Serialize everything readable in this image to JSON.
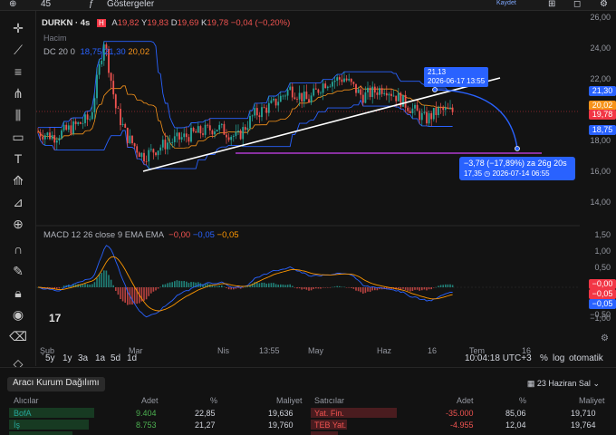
{
  "topbar": {
    "count": "45",
    "indicators_label": "Göstergeler",
    "save_label": "Kaydet"
  },
  "legend": {
    "symbol": "DURKN · 4s",
    "ohlc": {
      "a_label": "A",
      "a": "19,82",
      "y_label": "Y",
      "y": "19,83",
      "d_label": "D",
      "d": "19,69",
      "k_label": "K",
      "k": "19,78",
      "change": "−0,04 (−0,20%)"
    },
    "volume_label": "Hacim",
    "dc_label": "DC 20 0",
    "dc_values": [
      "18,75",
      "21,30",
      "20,02"
    ],
    "macd_label": "MACD 12 26 close 9 EMA EMA",
    "macd_values": [
      "−0,00",
      "−0,05",
      "−0,05"
    ]
  },
  "price_scale": {
    "ticks": [
      "26,00",
      "24,00",
      "22,00",
      "18,00",
      "16,00",
      "14,00"
    ],
    "tags": [
      {
        "value": "21,30",
        "color": "#2962ff"
      },
      {
        "value": "20,02",
        "color": "#f7931a"
      },
      {
        "value": "19,78",
        "color": "#f23645"
      },
      {
        "value": "18,75",
        "color": "#2962ff"
      }
    ]
  },
  "macd_scale": {
    "ticks": [
      "1,50",
      "1,00",
      "0,50",
      "−0,50",
      "−1,00"
    ],
    "tags": [
      {
        "value": "−0,00",
        "color": "#f23645"
      },
      {
        "value": "−0,05",
        "color": "#f23645"
      },
      {
        "value": "−0,05",
        "color": "#2962ff"
      }
    ]
  },
  "annotations": {
    "trend_label_value": "21,13",
    "trend_label_date": "2026-06-17 13:55",
    "projection_line1": "−3,78 (−17,89%) za 26g 20s",
    "projection_line2": "17,35 ◷ 2026-07-14 06:55"
  },
  "x_axis": [
    "Şub",
    "Mar",
    "Nis",
    "13:55",
    "May",
    "Haz",
    "16",
    "Tem",
    "16"
  ],
  "timeframes": [
    "5y",
    "1y",
    "3a",
    "1a",
    "5d",
    "1d"
  ],
  "status": {
    "clock": "10:04:18 UTC+3",
    "pct": "%",
    "log": "log",
    "auto": "otomatik"
  },
  "panel": {
    "title": "Aracı Kurum Dağılımı",
    "date": "23 Haziran Sal",
    "buyers_header": [
      "Alıcılar",
      "Adet",
      "%",
      "Maliyet"
    ],
    "sellers_header": [
      "Satıcılar",
      "Adet",
      "%",
      "Maliyet"
    ],
    "buyers": [
      {
        "name": "BofA",
        "qty": "9.404",
        "pct": "22,85",
        "cost": "19,636"
      },
      {
        "name": "İş",
        "qty": "8.753",
        "pct": "21,27",
        "cost": "19,760"
      }
    ],
    "sellers": [
      {
        "name": "Yat. Fin.",
        "qty": "-35.000",
        "pct": "85,06",
        "cost": "19,710"
      },
      {
        "name": "TEB Yat.",
        "qty": "-4.955",
        "pct": "12,04",
        "cost": "19,764"
      }
    ]
  },
  "colors": {
    "up": "#26a69a",
    "down": "#ef5350",
    "dc": "#2962ff",
    "basis": "#f7931a",
    "signal": "#ff9800",
    "purple": "#b03ad0"
  }
}
